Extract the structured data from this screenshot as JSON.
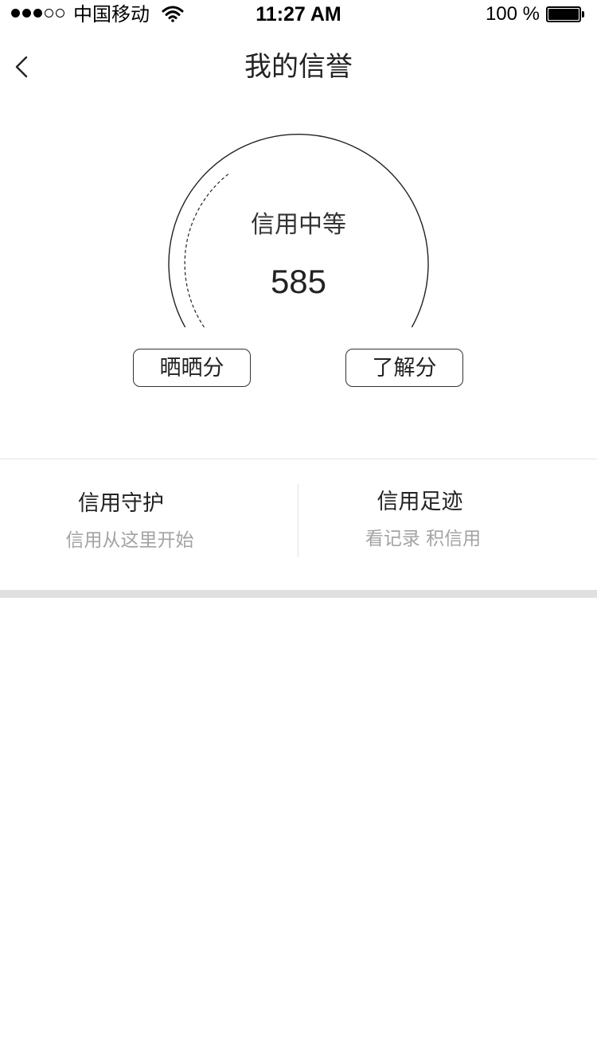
{
  "status_bar": {
    "carrier": "中国移动",
    "time": "11:27 AM",
    "battery": "100 %"
  },
  "nav": {
    "title": "我的信誉"
  },
  "score": {
    "level": "信用中等",
    "value": "585"
  },
  "buttons": {
    "share": "晒晒分",
    "learn": "了解分"
  },
  "cards": [
    {
      "title": "信用守护",
      "subtitle": "信用从这里开始"
    },
    {
      "title": "信用足迹",
      "subtitle": "看记录 积信用"
    }
  ],
  "colors": {
    "text": "#222222",
    "muted": "#a3a3a3",
    "divider": "#e2e2e2",
    "band": "#e0e0e0"
  }
}
